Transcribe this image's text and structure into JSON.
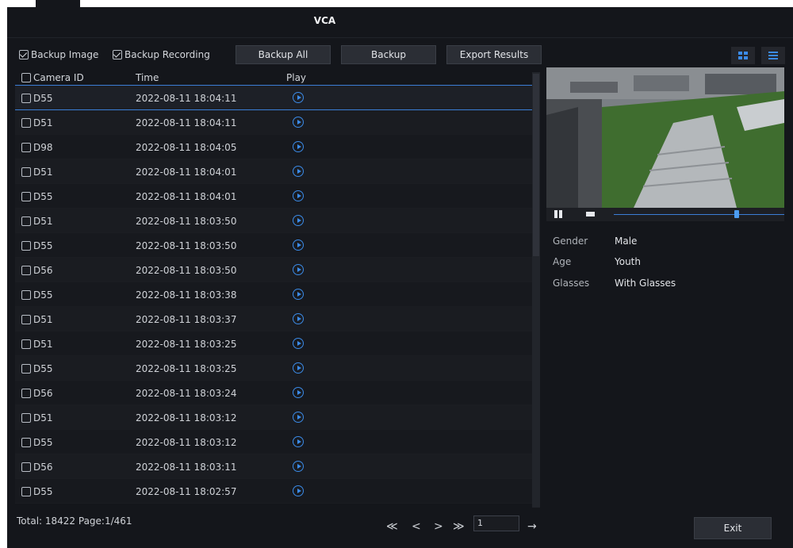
{
  "window": {
    "title": "VCA"
  },
  "toolbar": {
    "backup_image_label": "Backup Image",
    "backup_image_checked": true,
    "backup_recording_label": "Backup Recording",
    "backup_recording_checked": true,
    "backup_all_label": "Backup All",
    "backup_label": "Backup",
    "export_label": "Export Results"
  },
  "view_toggle": {
    "grid_icon": "grid-view-icon",
    "list_icon": "list-view-icon",
    "active": "grid"
  },
  "table": {
    "headers": {
      "camera_id": "Camera ID",
      "time": "Time",
      "play": "Play"
    },
    "rows": [
      {
        "camera": "D55",
        "time": "2022-08-11 18:04:11"
      },
      {
        "camera": "D51",
        "time": "2022-08-11 18:04:11"
      },
      {
        "camera": "D98",
        "time": "2022-08-11 18:04:05"
      },
      {
        "camera": "D51",
        "time": "2022-08-11 18:04:01"
      },
      {
        "camera": "D55",
        "time": "2022-08-11 18:04:01"
      },
      {
        "camera": "D51",
        "time": "2022-08-11 18:03:50"
      },
      {
        "camera": "D55",
        "time": "2022-08-11 18:03:50"
      },
      {
        "camera": "D56",
        "time": "2022-08-11 18:03:50"
      },
      {
        "camera": "D55",
        "time": "2022-08-11 18:03:38"
      },
      {
        "camera": "D51",
        "time": "2022-08-11 18:03:37"
      },
      {
        "camera": "D51",
        "time": "2022-08-11 18:03:25"
      },
      {
        "camera": "D55",
        "time": "2022-08-11 18:03:25"
      },
      {
        "camera": "D56",
        "time": "2022-08-11 18:03:24"
      },
      {
        "camera": "D51",
        "time": "2022-08-11 18:03:12"
      },
      {
        "camera": "D55",
        "time": "2022-08-11 18:03:12"
      },
      {
        "camera": "D56",
        "time": "2022-08-11 18:03:11"
      },
      {
        "camera": "D55",
        "time": "2022-08-11 18:02:57"
      }
    ]
  },
  "footer": {
    "total_text": "Total: 18422  Page:1/461",
    "first_icon": "≪",
    "prev_icon": "<",
    "next_icon": ">",
    "last_icon": "≫",
    "page_value": "1",
    "go_icon": "→",
    "exit_label": "Exit"
  },
  "details": {
    "gender_label": "Gender",
    "gender_value": "Male",
    "age_label": "Age",
    "age_value": "Youth",
    "glasses_label": "Glasses",
    "glasses_value": "With Glasses"
  },
  "player": {
    "progress": 0.7
  },
  "colors": {
    "accent": "#3b8be8",
    "background": "#14161b"
  }
}
